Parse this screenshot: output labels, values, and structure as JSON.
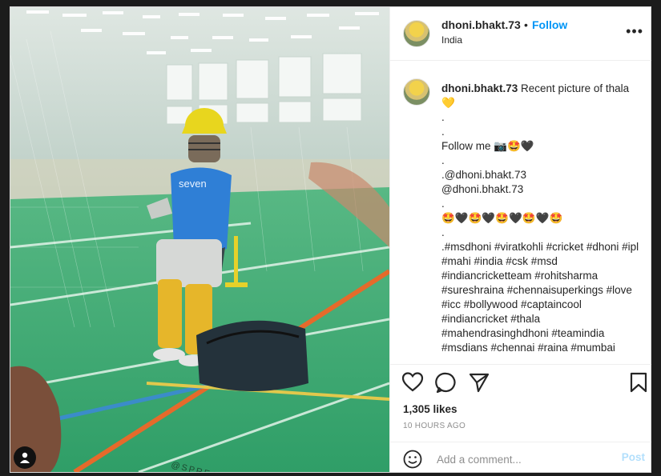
{
  "post": {
    "username": "dhoni.bhakt.73",
    "separator": "•",
    "follow_label": "Follow",
    "location": "India",
    "more_glyph": "•••",
    "photo_watermark": "@SPREAD_DHONISM"
  },
  "caption": {
    "username": "dhoni.bhakt.73",
    "first_text": "Recent picture of thala 💛",
    "lines": [
      ".",
      ".",
      "Follow me 📷🤩🖤",
      ".",
      ".@dhoni.bhakt.73",
      "@dhoni.bhakt.73",
      ".",
      "🤩🖤🤩🖤🤩🖤🤩🖤🤩",
      ".",
      ".#msdhoni #viratkohli #cricket #dhoni #ipl #mahi #india #csk #msd #indiancricketteam #rohitsharma #sureshraina #chennaisuperkings #love #icc #bollywood #captaincool #indiancricket #thala #mahendrasinghdhoni #teamindia #msdians #chennai #raina #mumbai"
    ]
  },
  "engagement": {
    "likes": "1,305 likes",
    "timestamp": "10 HOURS AGO"
  },
  "comment": {
    "placeholder": "Add a comment...",
    "post_label": "Post"
  },
  "icons": {
    "like": "heart-icon",
    "comment": "comment-icon",
    "share": "share-icon",
    "save": "bookmark-icon",
    "emoji": "smile-icon",
    "more": "more-options-icon",
    "user": "user-tag-icon"
  },
  "colors": {
    "follow_blue": "#0095f6",
    "post_disabled_blue": "#b2dffc",
    "text": "#262626",
    "muted": "#8e8e8e"
  }
}
